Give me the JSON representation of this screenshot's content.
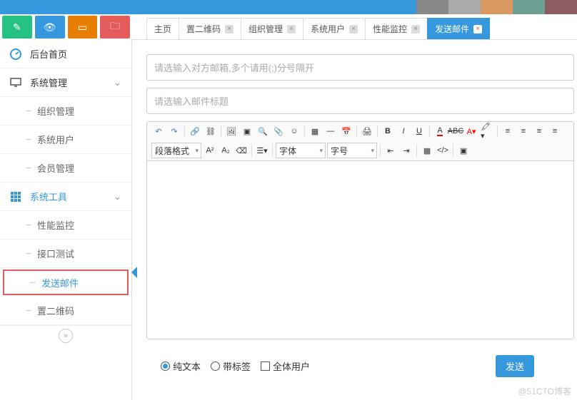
{
  "tabs": [
    {
      "label": "主页",
      "closable": false
    },
    {
      "label": "置二维码",
      "closable": true
    },
    {
      "label": "组织管理",
      "closable": true
    },
    {
      "label": "系统用户",
      "closable": true
    },
    {
      "label": "性能监控",
      "closable": true
    },
    {
      "label": "发送邮件",
      "closable": true,
      "active": true
    }
  ],
  "sidebar": {
    "home": "后台首页",
    "sys_mgmt": "系统管理",
    "items_sys": [
      "组织管理",
      "系统用户",
      "会员管理"
    ],
    "sys_tools": "系统工具",
    "items_tools": [
      "性能监控",
      "接口测试",
      "发送邮件",
      "置二维码"
    ]
  },
  "form": {
    "recipient_placeholder": "请选输入对方邮箱,多个请用(;)分号隔开",
    "subject_placeholder": "请选输入邮件标题",
    "selects": {
      "format": "段落格式",
      "font": "字体",
      "size": "字号"
    },
    "radio_plain": "纯文本",
    "radio_tag": "带标签",
    "chk_all": "全体用户",
    "send": "发送"
  },
  "watermark": "@51CTO博客"
}
